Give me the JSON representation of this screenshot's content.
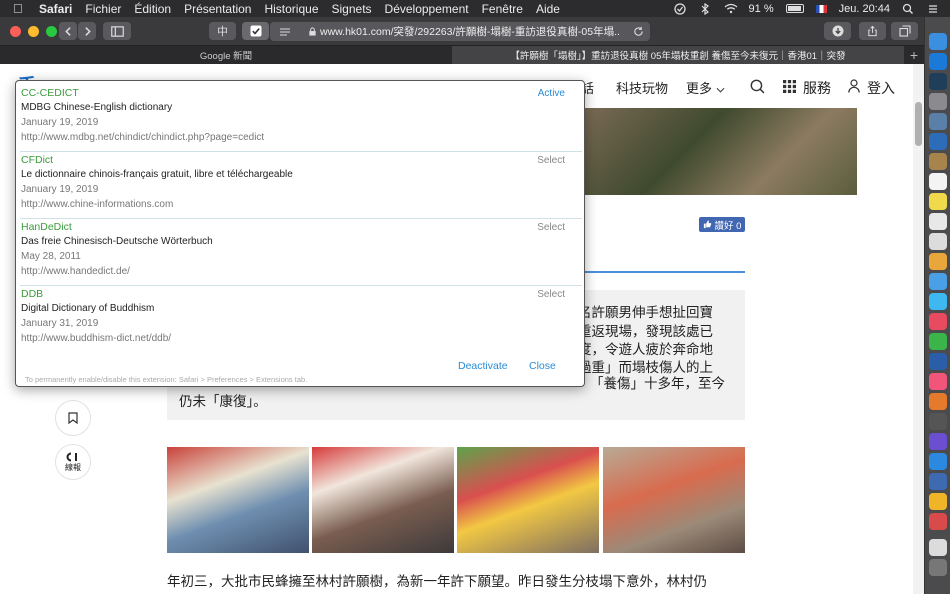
{
  "menubar": {
    "app": "Safari",
    "items": [
      "Fichier",
      "Édition",
      "Présentation",
      "Historique",
      "Signets",
      "Développement",
      "Fenêtre",
      "Aide"
    ],
    "battery": "91 %",
    "clock": "Jeu. 20:44"
  },
  "toolbar": {
    "reader_btn": "中",
    "url": "www.hk01.com/突發/292263/許願樹-塌樹-重訪退役真樹-05年塌..."
  },
  "tabs": [
    {
      "label": "Google 新聞",
      "active": false
    },
    {
      "label": "【許願樹「塌樹」】重訪退役真樹 05年塌枝重創 養傷至今未復元｜香港01｜突發",
      "active": true
    }
  ],
  "page": {
    "logo": "香",
    "nav_links": [
      "話",
      "科技玩物",
      "更多",
      "服務",
      "登入"
    ],
    "like_label": "讚好 0",
    "article_lines": [
      "名許願男伸手想扯回寶",
      "重返現場，發現該處已",
      "度，令遊人疲於奔命地",
      "過重」而塌枝傷人的上"
    ],
    "article_tail": "「養傷」十多年，至今",
    "article_end": "仍未「康復」。",
    "side_label": "線報",
    "paragraph": "年初三，大批市民蜂擁至林村許願樹，為新一年許下願望。昨日發生分枝塌下意外，林村仍"
  },
  "popover": {
    "dictionaries": [
      {
        "name": "CC-CEDICT",
        "desc": "MDBG Chinese-English dictionary",
        "date": "January 19, 2019",
        "url": "http://www.mdbg.net/chindict/chindict.php?page=cedict",
        "action": "Active"
      },
      {
        "name": "CFDict",
        "desc": "Le dictionnaire chinois-français gratuit, libre et téléchargeable",
        "date": "January 19, 2019",
        "url": "http://www.chine-informations.com",
        "action": "Select"
      },
      {
        "name": "HanDeDict",
        "desc": "Das freie Chinesisch-Deutsche Wörterbuch",
        "date": "May 28, 2011",
        "url": "http://www.handedict.de/",
        "action": "Select"
      },
      {
        "name": "DDB",
        "desc": "Digital Dictionary of Buddhism",
        "date": "January 31, 2019",
        "url": "http://www.buddhism-dict.net/ddb/",
        "action": "Select"
      }
    ],
    "deactivate": "Deactivate",
    "close": "Close",
    "note": "To permanently enable/disable this extension: Safari > Preferences > Extensions tab."
  },
  "colors": {
    "accent": "#2a8bd6",
    "dict_name": "#3a9b3a",
    "menubar": "#2c2c2e"
  }
}
